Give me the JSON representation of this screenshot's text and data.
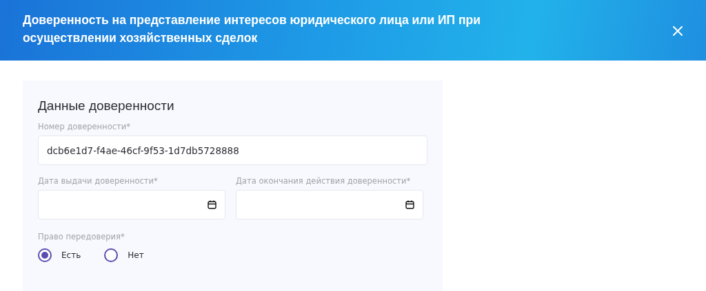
{
  "header": {
    "title": "Доверенность на представление интересов юридического лица или ИП при осуществлении хозяйственных сделок"
  },
  "form": {
    "heading": "Данные доверенности",
    "number_field": {
      "label": "Номер доверенности*",
      "value": "dcb6e1d7-f4ae-46cf-9f53-1d7db5728888"
    },
    "date_fields": [
      {
        "label": "Дата выдачи доверенности*"
      },
      {
        "label": "Дата окончания действия доверенности*"
      }
    ],
    "redelegation": {
      "label": "Право передоверия*",
      "options": [
        {
          "label": "Есть",
          "selected": true
        },
        {
          "label": "Нет",
          "selected": false
        }
      ]
    }
  }
}
